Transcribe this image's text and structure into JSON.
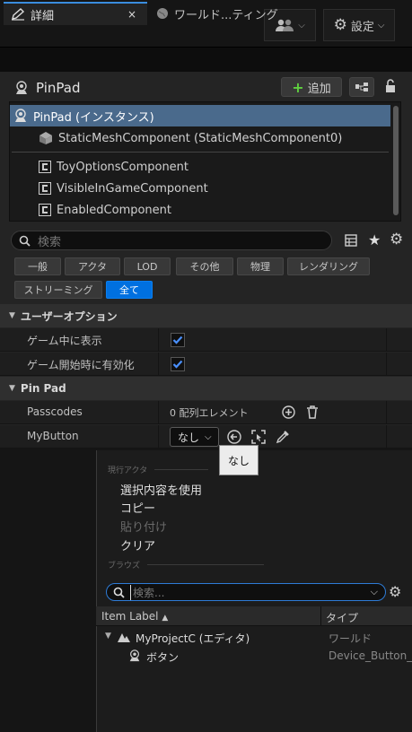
{
  "topbar": {
    "users_label": "",
    "settings_label": "設定"
  },
  "tabs": [
    {
      "label": "詳細"
    },
    {
      "label": "ワールド...ティング"
    }
  ],
  "header": {
    "title": "PinPad",
    "add_label": "追加"
  },
  "tree": {
    "items": [
      {
        "label": "PinPad (インスタンス)"
      },
      {
        "label": "StaticMeshComponent (StaticMeshComponent0)"
      },
      {
        "label": "ToyOptionsComponent"
      },
      {
        "label": "VisibleInGameComponent"
      },
      {
        "label": "EnabledComponent"
      }
    ]
  },
  "search": {
    "placeholder": "検索"
  },
  "filters": [
    "一般",
    "アクタ",
    "LOD",
    "その他",
    "物理",
    "レンダリング",
    "ストリーミング",
    "全て"
  ],
  "categories": {
    "user_options": "ユーザーオプション",
    "pin_pad": "Pin Pad"
  },
  "props": {
    "visible_in_game": "ゲーム中に表示",
    "enabled_on_start": "ゲーム開始時に有効化",
    "passcodes": "Passcodes",
    "passcodes_value": "0 配列エレメント",
    "mybutton": "MyButton",
    "mybutton_value": "なし"
  },
  "tooltip": "なし",
  "menu": {
    "section_current": "現行アクタ",
    "use_selected": "選択内容を使用",
    "copy": "コピー",
    "paste": "貼り付け",
    "clear": "クリア",
    "section_browse": "ブラウズ",
    "search_placeholder": "検索...",
    "col_item_label": "Item Label",
    "col_type": "タイプ",
    "rows": [
      {
        "label": "MyProjectC (エディタ)",
        "type": "ワールド"
      },
      {
        "label": "ボタン",
        "type": "Device_Button_V"
      }
    ]
  },
  "colors": {
    "accent": "#0070e0",
    "check": "#4a90ff",
    "selected_row": "#4a6a8c"
  }
}
